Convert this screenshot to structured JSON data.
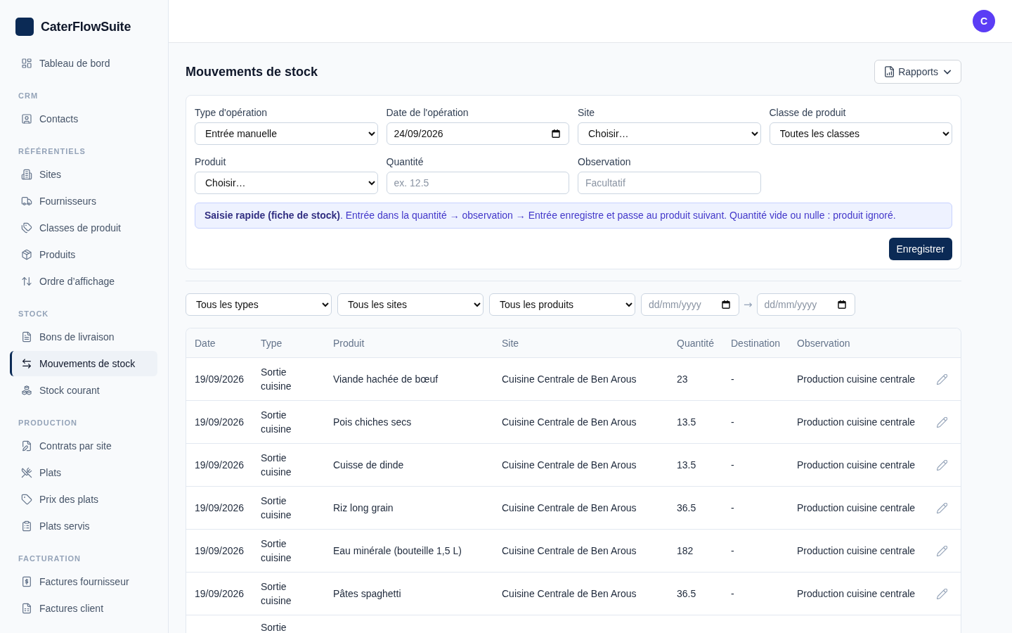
{
  "sidebar": {
    "brand": "CaterFlowSuite",
    "sections": [
      {
        "items": [
          {
            "label": "Tableau de bord",
            "selected": false
          }
        ]
      },
      {
        "title": "CRM",
        "items": [
          {
            "label": "Contacts",
            "selected": false
          }
        ]
      },
      {
        "title": "RÉFÉRENTIELS",
        "items": [
          {
            "label": "Sites",
            "selected": false
          },
          {
            "label": "Fournisseurs",
            "selected": false
          },
          {
            "label": "Classes de produit",
            "selected": false
          },
          {
            "label": "Produits",
            "selected": false
          },
          {
            "label": "Ordre d’affichage",
            "selected": false
          }
        ]
      },
      {
        "title": "STOCK",
        "items": [
          {
            "label": "Bons de livraison",
            "selected": false
          },
          {
            "label": "Mouvements de stock",
            "selected": true
          },
          {
            "label": "Stock courant",
            "selected": false
          }
        ]
      },
      {
        "title": "PRODUCTION",
        "items": [
          {
            "label": "Contrats par site",
            "selected": false
          },
          {
            "label": "Plats",
            "selected": false
          },
          {
            "label": "Prix des plats",
            "selected": false
          },
          {
            "label": "Plats servis",
            "selected": false
          }
        ]
      },
      {
        "title": "FACTURATION",
        "items": [
          {
            "label": "Factures fournisseur",
            "selected": false
          },
          {
            "label": "Factures client",
            "selected": false
          }
        ]
      }
    ]
  },
  "top_bar": {
    "avatar": "C"
  },
  "page": {
    "title": "Mouvements de stock",
    "reports_button": "Rapports"
  },
  "form": {
    "fields": [
      {
        "kind": "select",
        "label": "Type d'opération",
        "value": "Entrée manuelle"
      },
      {
        "kind": "date",
        "label": "Date de l'opération",
        "value": "24/09/2026"
      },
      {
        "kind": "select",
        "label": "Site",
        "value": "Choisir…"
      },
      {
        "kind": "select",
        "label": "Classe de produit",
        "value": "Toutes les classes"
      },
      {
        "kind": "select",
        "label": "Produit",
        "value": "Choisir…"
      },
      {
        "kind": "text",
        "label": "Quantité",
        "placeholder": "ex. 12.5"
      },
      {
        "kind": "text",
        "label": "Observation",
        "placeholder": "Facultatif"
      }
    ],
    "info": "**Saisie rapide (fiche de stock)**. Entrée dans la quantité → observation → Entrée enregistre et passe au produit suivant. Quantité vide ou nulle : produit ignoré.",
    "submit_button": "Enregistrer"
  },
  "filters": {
    "controls": [
      {
        "kind": "select",
        "value": "Tous les types"
      },
      {
        "kind": "select",
        "value": "Tous les sites"
      },
      {
        "kind": "select",
        "value": "Tous les produits"
      },
      {
        "kind": "date",
        "placeholder": "dd/mm/yyyy"
      },
      {
        "kind": "range_separator",
        "text": "→"
      },
      {
        "kind": "date",
        "placeholder": "dd/mm/yyyy"
      }
    ]
  },
  "table": {
    "columns": [
      "Date",
      "Type",
      "Produit",
      "Site",
      "Quantité",
      "Destination",
      "Observation"
    ],
    "rows": [
      {
        "date": "19/09/2026",
        "type": "Sortie cuisine",
        "product": "Viande hachée de bœuf",
        "site": "Cuisine Centrale de Ben Arous",
        "quantity": "23",
        "destination": "-",
        "observation": "Production cuisine centrale"
      },
      {
        "date": "19/09/2026",
        "type": "Sortie cuisine",
        "product": "Pois chiches secs",
        "site": "Cuisine Centrale de Ben Arous",
        "quantity": "13.5",
        "destination": "-",
        "observation": "Production cuisine centrale"
      },
      {
        "date": "19/09/2026",
        "type": "Sortie cuisine",
        "product": "Cuisse de dinde",
        "site": "Cuisine Centrale de Ben Arous",
        "quantity": "13.5",
        "destination": "-",
        "observation": "Production cuisine centrale"
      },
      {
        "date": "19/09/2026",
        "type": "Sortie cuisine",
        "product": "Riz long grain",
        "site": "Cuisine Centrale de Ben Arous",
        "quantity": "36.5",
        "destination": "-",
        "observation": "Production cuisine centrale"
      },
      {
        "date": "19/09/2026",
        "type": "Sortie cuisine",
        "product": "Eau minérale (bouteille 1,5 L)",
        "site": "Cuisine Centrale de Ben Arous",
        "quantity": "182",
        "destination": "-",
        "observation": "Production cuisine centrale"
      },
      {
        "date": "19/09/2026",
        "type": "Sortie cuisine",
        "product": "Pâtes spaghetti",
        "site": "Cuisine Centrale de Ben Arous",
        "quantity": "36.5",
        "destination": "-",
        "observation": "Production cuisine centrale"
      },
      {
        "type": "Sortie"
      }
    ]
  }
}
